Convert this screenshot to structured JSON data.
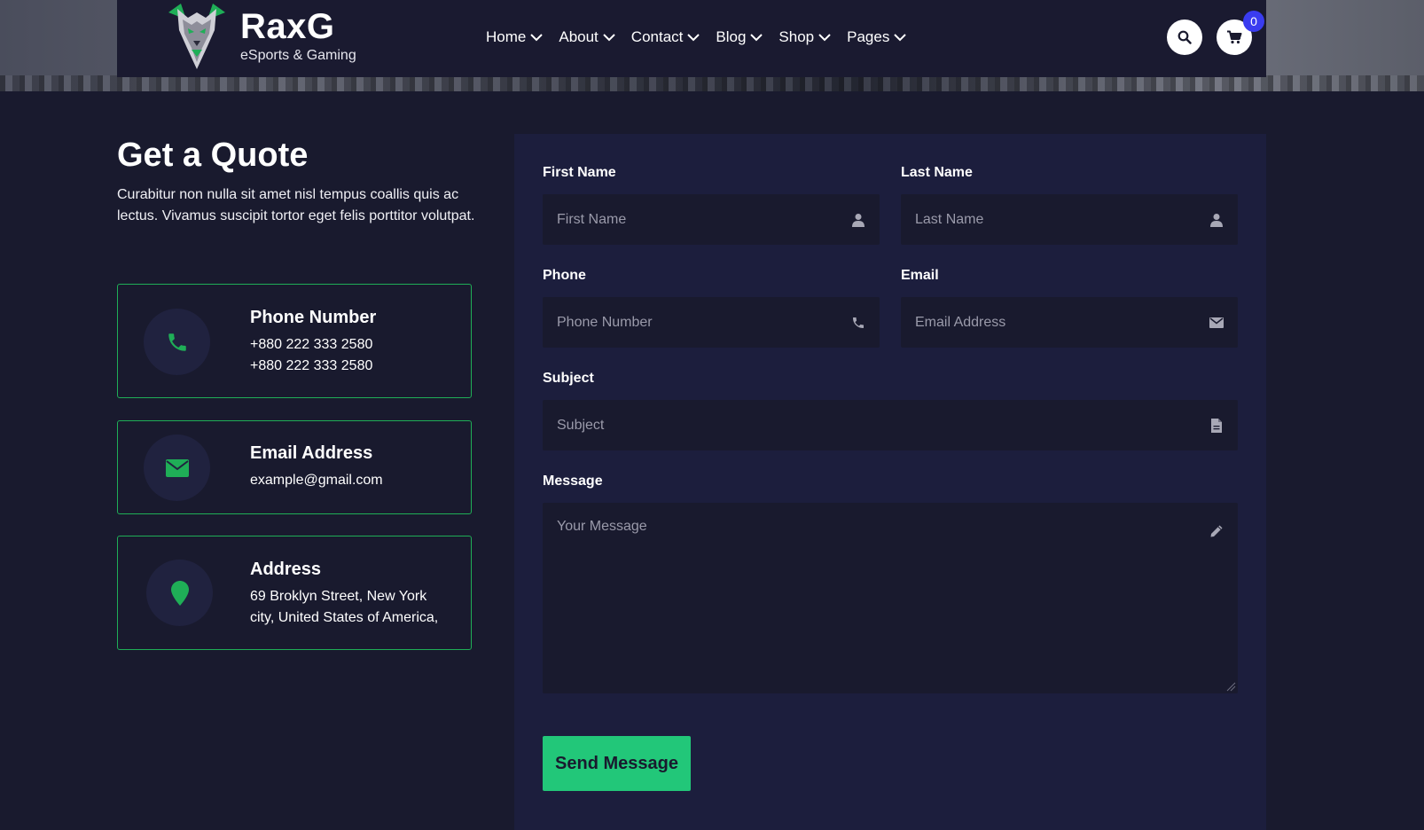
{
  "brand": {
    "name": "RaxG",
    "tagline": "eSports & Gaming"
  },
  "nav": {
    "items": [
      {
        "label": "Home"
      },
      {
        "label": "About"
      },
      {
        "label": "Contact"
      },
      {
        "label": "Blog"
      },
      {
        "label": "Shop"
      },
      {
        "label": "Pages"
      }
    ],
    "cart_count": "0"
  },
  "quote": {
    "title": "Get a Quote",
    "description": "Curabitur non nulla sit amet nisl tempus coallis quis ac lectus. Vivamus suscipit tortor eget felis porttitor volutpat."
  },
  "info_cards": [
    {
      "title": "Phone Number",
      "lines": [
        "+880 222 333 2580",
        "+880 222 333 2580"
      ],
      "icon": "phone-icon"
    },
    {
      "title": "Email Address",
      "lines": [
        "example@gmail.com"
      ],
      "icon": "envelope-icon"
    },
    {
      "title": "Address",
      "lines": [
        "69 Broklyn Street, New York",
        "city, United States of America,"
      ],
      "icon": "map-pin-icon"
    }
  ],
  "form": {
    "first_name": {
      "label": "First Name",
      "placeholder": "First Name",
      "icon": "user-icon"
    },
    "last_name": {
      "label": "Last Name",
      "placeholder": "Last Name",
      "icon": "user-icon"
    },
    "phone": {
      "label": "Phone",
      "placeholder": "Phone Number",
      "icon": "phone-icon"
    },
    "email": {
      "label": "Email",
      "placeholder": "Email Address",
      "icon": "envelope-icon"
    },
    "subject": {
      "label": "Subject",
      "placeholder": "Subject",
      "icon": "file-icon"
    },
    "message": {
      "label": "Message",
      "placeholder": "Your Message",
      "icon": "pencil-icon"
    },
    "submit_label": "Send Message"
  },
  "colors": {
    "accent": "#22c779",
    "background": "#191a2e",
    "panel": "#1c1e3d",
    "badge": "#3a3cf0"
  }
}
